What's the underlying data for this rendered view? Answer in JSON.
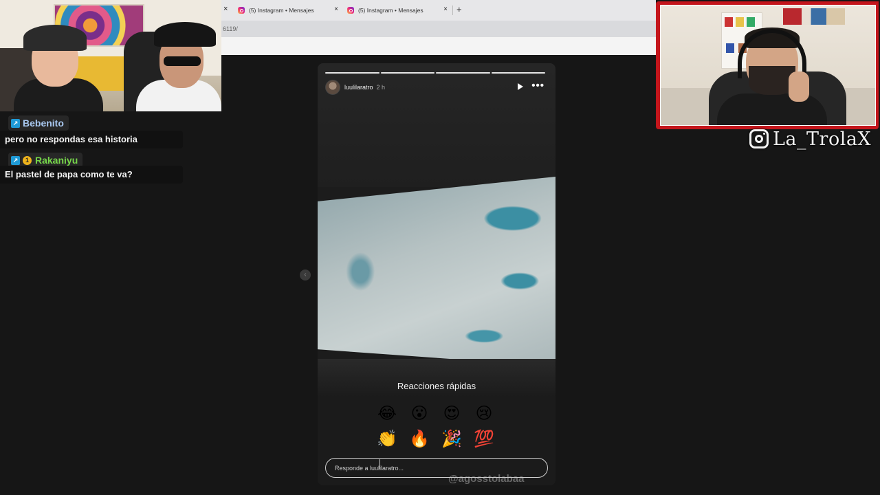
{
  "browser": {
    "tabs": [
      {
        "title": "(5) Instagram • Mensajes",
        "close": "×"
      },
      {
        "title": "(5) Instagram • Mensajes",
        "close": "×"
      }
    ],
    "leftover_close": "×",
    "new_tab": "+",
    "url_fragment": "6119/"
  },
  "chat": {
    "messages": [
      {
        "user": "Bebenito",
        "user_color": "#a9c8f0",
        "badges": [
          "prime"
        ],
        "text": "pero no respondas esa historia"
      },
      {
        "user": "Rakaniyu",
        "user_color": "#76d64a",
        "badges": [
          "prime",
          "sub-1"
        ],
        "sub_badge_text": "1",
        "text": "El pastel de papa como te va?"
      }
    ]
  },
  "overlay": {
    "instagram_handle": "La_TrolaX",
    "frame_color": "#c4161c"
  },
  "story": {
    "username": "luulilaratro",
    "time_ago": "2 h",
    "progress_segments": 4,
    "quick_reactions_title": "Reacciones rápidas",
    "reactions": [
      {
        "name": "laughing-tears",
        "glyph": "😂"
      },
      {
        "name": "surprised",
        "glyph": "😮"
      },
      {
        "name": "heart-eyes",
        "glyph": "😍"
      },
      {
        "name": "crying",
        "glyph": "😢"
      },
      {
        "name": "clapping",
        "glyph": "👏"
      },
      {
        "name": "fire",
        "glyph": "🔥"
      },
      {
        "name": "party",
        "glyph": "🎉"
      },
      {
        "name": "hundred",
        "glyph": "💯"
      }
    ],
    "reply_placeholder": "Responde a luulilaratro...",
    "watermark": "@agosstolabaa",
    "prev_arrow": "‹"
  }
}
